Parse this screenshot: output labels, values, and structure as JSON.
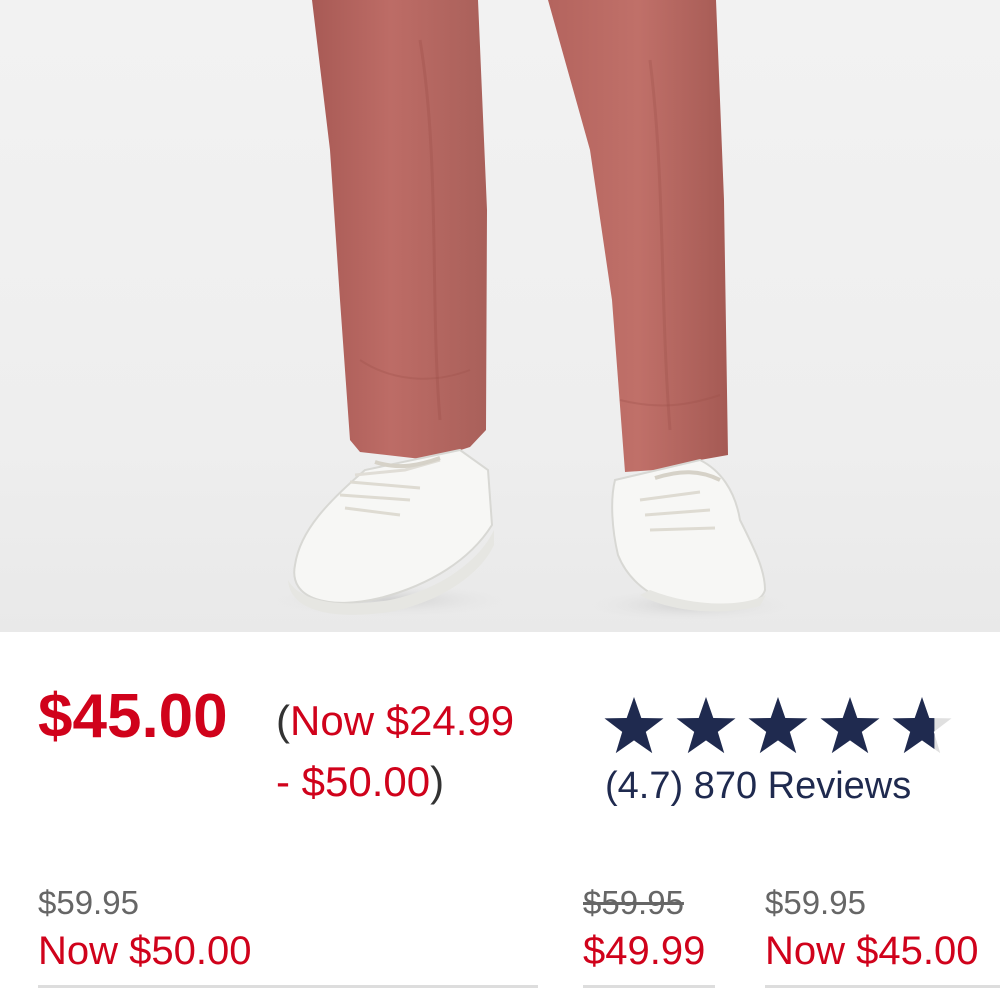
{
  "product": {
    "image_alt": "product-photo-pants-and-sneakers",
    "price": "$45.00",
    "price_range": {
      "open_paren": "(",
      "line1": "Now $24.99",
      "line2": "- $50.00",
      "close_paren": ")"
    }
  },
  "rating": {
    "value": 4.7,
    "max": 5,
    "text": "(4.7) 870 Reviews",
    "star_color": "#1f2a4f"
  },
  "variants": [
    {
      "was": "$59.95",
      "was_struck": false,
      "now": "Now $50.00"
    },
    {
      "was": "$59.95",
      "was_struck": true,
      "now": "$49.99"
    },
    {
      "was": "$59.95",
      "was_struck": false,
      "now": "Now $45.00"
    }
  ],
  "colors": {
    "sale_red": "#d0021b",
    "muted_gray": "#666666",
    "rating_navy": "#1f2a4f",
    "pants": "#b66761"
  }
}
